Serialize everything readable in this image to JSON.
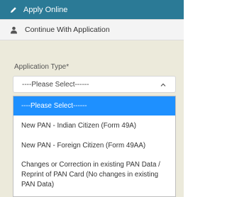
{
  "tabs": {
    "apply_online": "Apply Online",
    "continue_with_application": "Continue With Application"
  },
  "form": {
    "application_type_label": "Application Type*",
    "select_value": "----Please Select------"
  },
  "dropdown": {
    "options": [
      "----Please Select------",
      "New PAN - Indian Citizen (Form 49A)",
      "New PAN - Foreign Citizen (Form 49AA)",
      "Changes or Correction in existing PAN Data / Reprint of PAN Card (No changes in existing PAN Data)"
    ],
    "selected_index": 0
  },
  "colors": {
    "tab_active_bg": "#2b7a96",
    "panel_bg": "#eceadb",
    "highlight": "#1e90ff"
  },
  "icons": {
    "apply_online": "pencil-icon",
    "continue_with_application": "user-icon",
    "select_chevron": "chevron-up-icon"
  }
}
